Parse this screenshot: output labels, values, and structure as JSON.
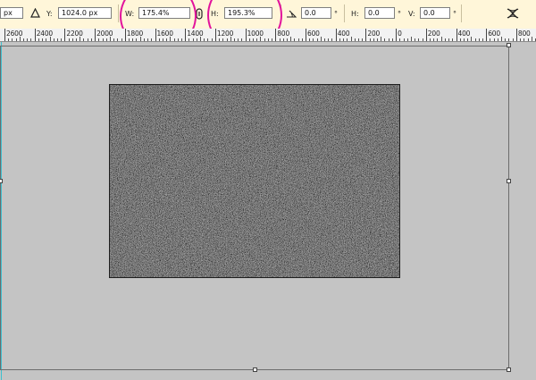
{
  "options_bar": {
    "x_unit": "px",
    "y_label": "Y:",
    "y_value": "1024.0 px",
    "w_label": "W:",
    "w_value": "175.4%",
    "h_label": "H:",
    "h_value": "195.3%",
    "angle_value": "0.0",
    "degree_symbol": "°",
    "hskew_label": "H:",
    "hskew_value": "0.0",
    "vskew_label": "V:",
    "vskew_value": "0.0",
    "highlight_color": "#e2139c"
  },
  "ruler": {
    "labels": [
      "2600",
      "2400",
      "2200",
      "2000",
      "1800",
      "1600",
      "1400",
      "1200",
      "1000",
      "800",
      "600",
      "400",
      "200",
      "0",
      "200",
      "400",
      "600",
      "800"
    ]
  },
  "canvas": {
    "background_color": "#c4c4c4",
    "layer_fill": "gray noise texture"
  }
}
